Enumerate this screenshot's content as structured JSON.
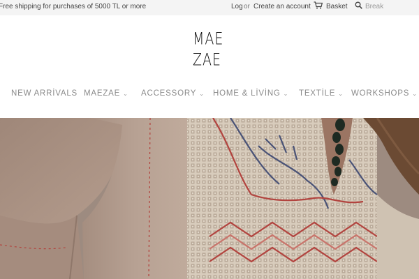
{
  "topbar": {
    "promo": "Free shipping for purchases of 5000 TL or more",
    "login": "Log",
    "or": "or",
    "create_account": "Create an account",
    "basket": "Basket",
    "basket_icon": "cart-icon",
    "search_icon": "search-icon",
    "search_placeholder": "Break"
  },
  "logo": {
    "line1": "MAE",
    "line2": "ZAE"
  },
  "nav": {
    "items": [
      {
        "label": "NEW ARRİVALS",
        "dropdown": false
      },
      {
        "label": "MAEZAE",
        "dropdown": true
      },
      {
        "label": "ACCESSORY",
        "dropdown": true
      },
      {
        "label": "HOME & LİVİNG",
        "dropdown": true
      },
      {
        "label": "TEXTİLE",
        "dropdown": true
      },
      {
        "label": "WORKSHOPS",
        "dropdown": true
      }
    ],
    "chevron_icon": "chevron-down-icon"
  },
  "hero": {
    "colors": {
      "linen": "#b59f92",
      "lace": "#d9cdbd",
      "thread_red": "#b2443f",
      "thread_blue": "#4a5377",
      "hair": "#6b4a33",
      "beads": "#1e2a22"
    }
  }
}
